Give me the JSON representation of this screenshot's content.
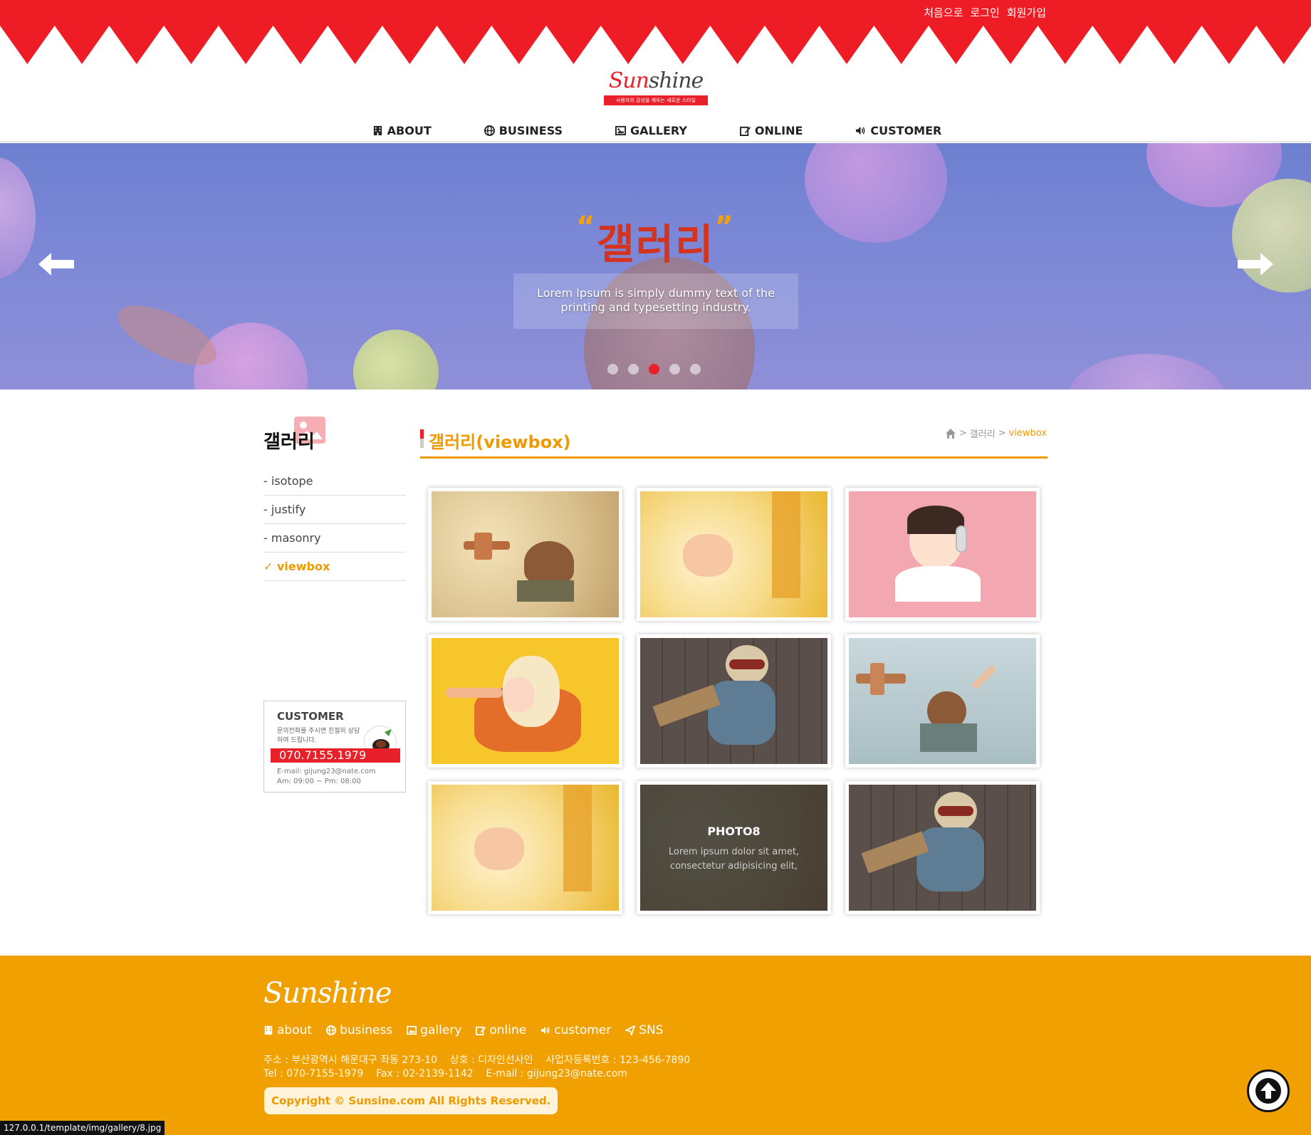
{
  "header": {
    "links": [
      "처음으로",
      "로그인",
      "회원가입"
    ],
    "logo_word_a": "Sun",
    "logo_word_b": "shine",
    "logo_tagline": "사용자의 감성을 깨우는 새로운 스타일"
  },
  "nav": [
    {
      "label": "ABOUT",
      "icon": "building-icon"
    },
    {
      "label": "BUSINESS",
      "icon": "globe-icon"
    },
    {
      "label": "GALLERY",
      "icon": "image-icon"
    },
    {
      "label": "ONLINE",
      "icon": "edit-icon"
    },
    {
      "label": "CUSTOMER",
      "icon": "speaker-icon"
    }
  ],
  "hero": {
    "title": "갤러리",
    "open_quote": "“",
    "close_quote": "”",
    "caption": "Lorem Ipsum is simply dummy text of the printing and typesetting industry.",
    "slide_count": 5,
    "active_slide": 3
  },
  "sidebar": {
    "title": "갤러리",
    "items": [
      {
        "label": "- isotope",
        "active": false
      },
      {
        "label": "- justify",
        "active": false
      },
      {
        "label": "- masonry",
        "active": false
      },
      {
        "label": "viewbox",
        "active": true
      }
    ],
    "customer": {
      "title": "CUSTOMER",
      "desc": "문의전화를 주시면 친절히 상담하여 드립니다.",
      "phone": "070.7155.1979",
      "email": "E-mail: gijung23@nate.com",
      "hours": "Am: 09:00 ~ Pm: 08:00"
    }
  },
  "content": {
    "title": "갤러리(viewbox)",
    "breadcrumb": [
      "갤러리",
      "viewbox"
    ],
    "hover_item": {
      "title": "PHOTO8",
      "desc": "Lorem ipsum dolor sit amet, consectetur adipisicing elit,"
    }
  },
  "gallery": [
    {
      "alt": "child with toy airplane beige"
    },
    {
      "alt": "baby hand yellow blanket"
    },
    {
      "alt": "laughing baby with headphones pink"
    },
    {
      "alt": "baby eating yellow"
    },
    {
      "alt": "boy pilot on wooden floor"
    },
    {
      "alt": "child with toy airplane sky"
    },
    {
      "alt": "baby hand yellow blanket"
    },
    {
      "alt": "photo8 hover"
    },
    {
      "alt": "boy pilot on wooden floor"
    }
  ],
  "footer": {
    "logo": "Sunshine",
    "links": [
      {
        "label": "about",
        "icon": "building-icon"
      },
      {
        "label": "business",
        "icon": "globe-icon"
      },
      {
        "label": "gallery",
        "icon": "image-icon"
      },
      {
        "label": "online",
        "icon": "edit-icon"
      },
      {
        "label": "customer",
        "icon": "speaker-icon"
      },
      {
        "label": "SNS",
        "icon": "send-icon"
      }
    ],
    "address": "주소 : 부산광역시 해운대구 좌동 273-10    상호 : 디자인선사인    사업자등록번호 : 123-456-7890",
    "contact": "Tel : 070-7155-1979    Fax : 02-2139-1142    E-mail : gijung23@nate.com",
    "copyright": "Copyright © Sunsine.com All Rights Reserved."
  },
  "status_url": "127.0.0.1/template/img/gallery/8.jpg",
  "colors": {
    "brand_red": "#e8202a",
    "accent_orange": "#f0a000"
  }
}
